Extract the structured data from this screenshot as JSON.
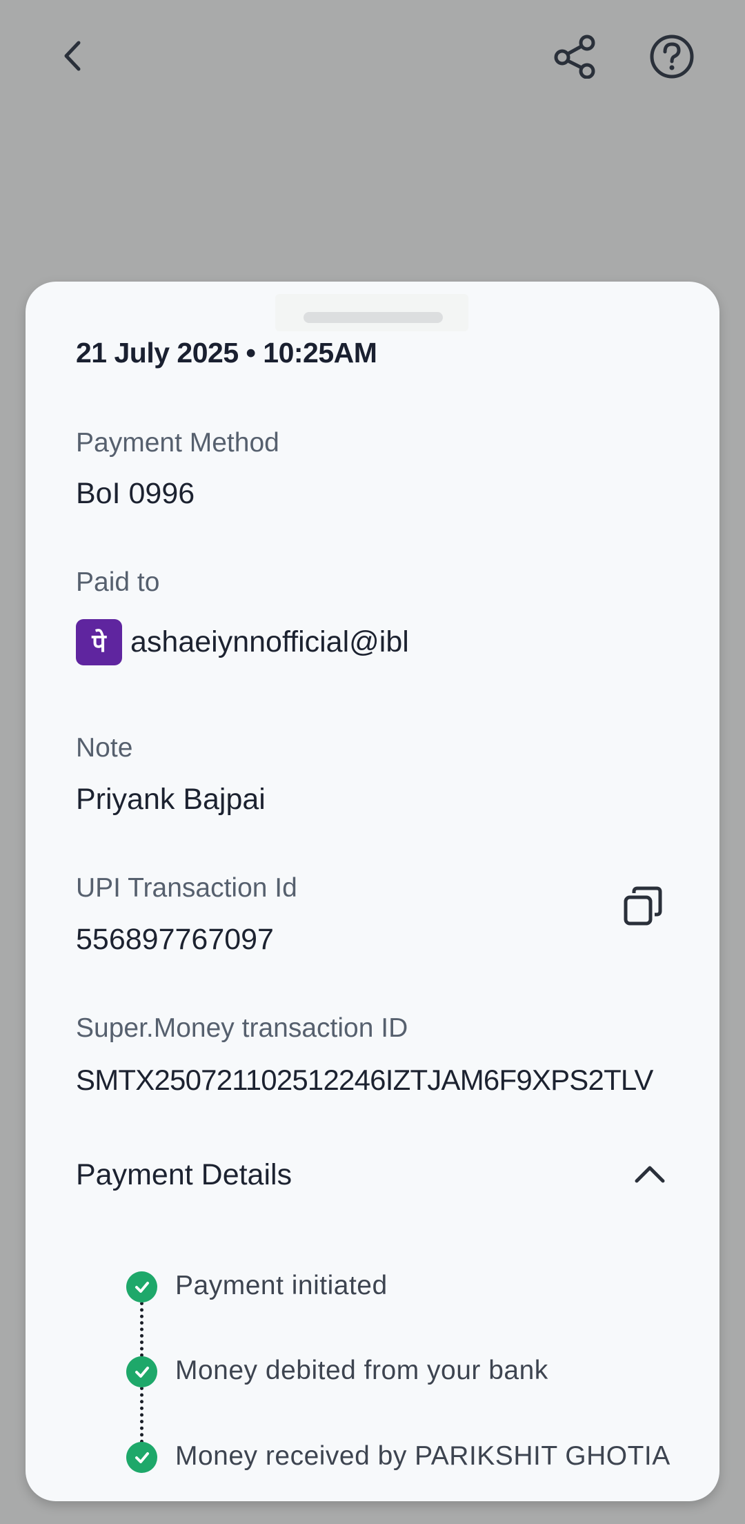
{
  "header": {
    "back_icon": "chevron-left-icon",
    "share_icon": "share-icon",
    "help_icon": "help-circle-icon"
  },
  "details": {
    "datetime": "21 July 2025 • 10:25AM",
    "payment_method_label": "Payment Method",
    "payment_method_value": "BoI 0996",
    "paid_to_label": "Paid to",
    "paid_to_logo_glyph": "पे",
    "paid_to_value": "ashaeiynnofficial@ibl",
    "note_label": "Note",
    "note_value": "Priyank Bajpai",
    "upi_label": "UPI Transaction Id",
    "upi_value": "556897767097",
    "supermoney_label": "Super.Money transaction ID",
    "supermoney_value": "SMTX250721102512246IZTJAM6F9XPS2TLV"
  },
  "payment_details": {
    "title": "Payment Details",
    "steps": [
      {
        "label": "Payment initiated",
        "status": "done"
      },
      {
        "label": "Money debited from your bank",
        "status": "done"
      },
      {
        "label": "Money received by PARIKSHIT GHOTIA",
        "status": "done"
      }
    ]
  },
  "colors": {
    "backdrop": "#a9aaaa",
    "sheet": "#f7f9fb",
    "success": "#1ea86a",
    "phonepe": "#5f259f"
  }
}
